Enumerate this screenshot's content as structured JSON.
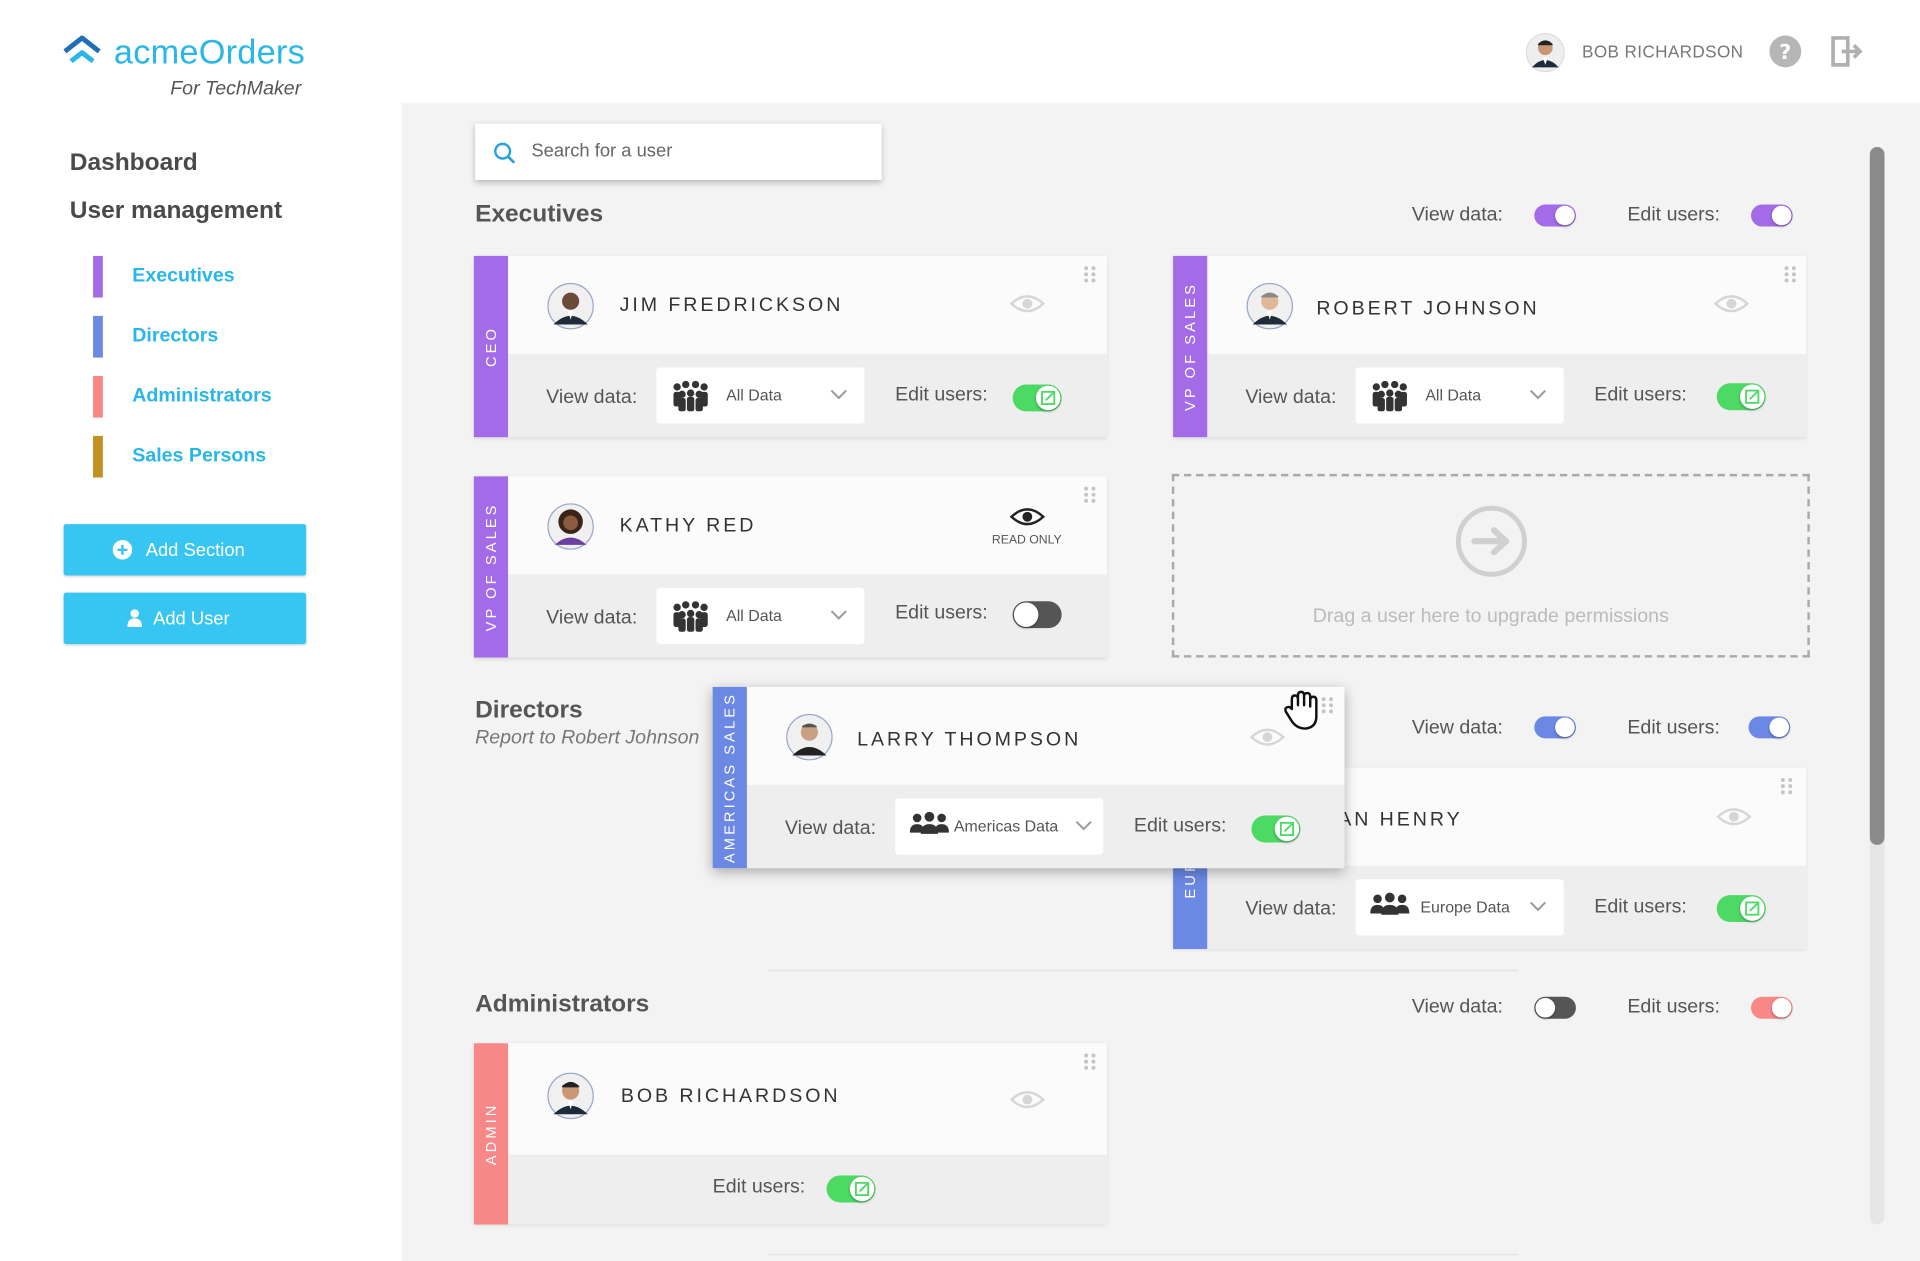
{
  "header": {
    "brand": "acmeOrders",
    "brand_sub": "For TechMaker",
    "user_name": "BOB RICHARDSON",
    "help_icon": "question-circle-icon",
    "logout_icon": "logout-icon"
  },
  "sidebar": {
    "dashboard": "Dashboard",
    "user_management": "User management",
    "items": [
      {
        "label": "Executives",
        "color": "#a36be8"
      },
      {
        "label": "Directors",
        "color": "#6a88e4"
      },
      {
        "label": "Administrators",
        "color": "#f88787"
      },
      {
        "label": "Sales Persons",
        "color": "#c2911f"
      }
    ],
    "add_section": "Add Section",
    "add_user": "Add User"
  },
  "search": {
    "placeholder": "Search for a user"
  },
  "labels": {
    "view_data": "View data:",
    "edit_users": "Edit users:"
  },
  "sections": {
    "executives": {
      "title": "Executives",
      "color": "#a36be8",
      "view_data_on": true,
      "edit_users_on": true,
      "users": [
        {
          "name": "JIM FREDRICKSON",
          "role": "CEO",
          "view_data": "All Data",
          "edit_users": true
        },
        {
          "name": "ROBERT JOHNSON",
          "role": "VP OF SALES",
          "view_data": "All Data",
          "edit_users": true
        },
        {
          "name": "KATHY RED",
          "role": "VP OF SALES",
          "view_data": "All Data",
          "edit_users": false,
          "status": "READ ONLY"
        }
      ],
      "dropzone": "Drag a user here to upgrade permissions"
    },
    "directors": {
      "title": "Directors",
      "subtitle": "Report to Robert Johnson",
      "color": "#6a88e4",
      "view_data_on": true,
      "edit_users_on": true,
      "users": [
        {
          "name": "LARRY THOMPSON",
          "role": "AMERICAS SALES",
          "view_data": "Americas Data",
          "edit_users": true
        },
        {
          "name": "IAN HENRY",
          "role": "EUROPE",
          "view_data": "Europe Data",
          "edit_users": true
        }
      ]
    },
    "administrators": {
      "title": "Administrators",
      "color": "#f88787",
      "view_data_on": false,
      "edit_users_on": true,
      "users": [
        {
          "name": "BOB RICHARDSON",
          "role": "ADMIN",
          "edit_users": true
        }
      ]
    }
  },
  "colors": {
    "accent": "#29b6e8",
    "toggle_on": "#4cd964",
    "toggle_off": "#555555"
  }
}
